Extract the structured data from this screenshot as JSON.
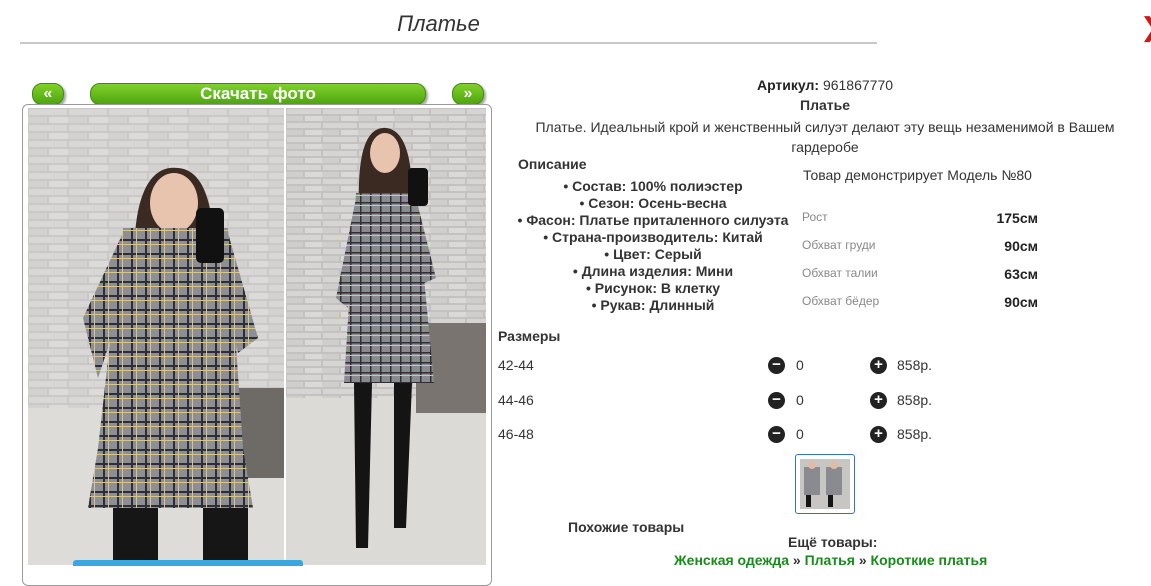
{
  "page": {
    "title": "Платье"
  },
  "gallery": {
    "prev_label": "«",
    "download_label": "Скачать фото",
    "next_label": "»"
  },
  "product": {
    "article_label": "Артикул:",
    "article_value": "961867770",
    "name": "Платье",
    "description": "Платье. Идеальный крой и женственный силуэт делают эту вещь незаменимой в Вашем гардеробе"
  },
  "description_section": {
    "heading": "Описание",
    "attributes": [
      "Состав: 100% полиэстер",
      "Сезон: Осень-весна",
      "Фасон: Платье приталенного силуэта",
      "Страна-производитель: Китай",
      "Цвет: Серый",
      "Длина изделия: Мини",
      "Рисунок: В клетку",
      "Рукав: Длинный"
    ]
  },
  "model": {
    "title": "Товар демонстрирует Модель №80",
    "measurements": [
      {
        "label": "Рост",
        "value": "175см"
      },
      {
        "label": "Обхват груди",
        "value": "90см"
      },
      {
        "label": "Обхват талии",
        "value": "63см"
      },
      {
        "label": "Обхват бёдер",
        "value": "90см"
      }
    ]
  },
  "sizes": {
    "heading": "Размеры",
    "rows": [
      {
        "size": "42-44",
        "qty": "0",
        "price": "858р."
      },
      {
        "size": "44-46",
        "qty": "0",
        "price": "858р."
      },
      {
        "size": "46-48",
        "qty": "0",
        "price": "858р."
      }
    ]
  },
  "footer": {
    "similar_heading": "Похожие товары",
    "more_heading": "Ещё товары:",
    "crumbs": [
      "Женская одежда",
      "Платья",
      "Короткие платья"
    ],
    "separator": "»"
  },
  "colors": {
    "accent_green": "#4ea50f",
    "link_green": "#1a8a1a",
    "thumb_border": "#2e74c8"
  }
}
